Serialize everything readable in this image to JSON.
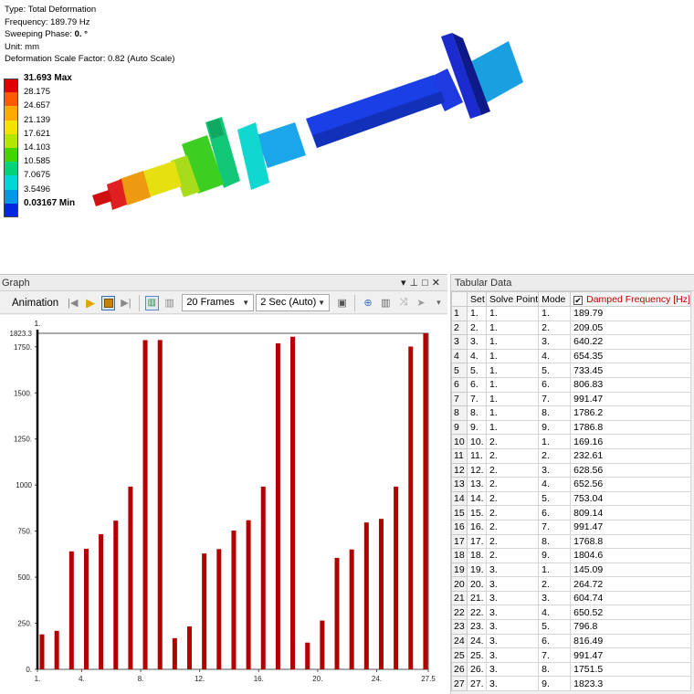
{
  "info": {
    "type_line": "Type: Total Deformation",
    "frequency_line": "Frequency: 189.79 Hz",
    "phase_line_prefix": "Sweeping Phase: ",
    "phase_value": "0. °",
    "unit_line": "Unit: mm",
    "scale_line": "Deformation Scale Factor: 0.82 (Auto Scale)"
  },
  "legend": [
    {
      "label": "31.693 Max",
      "bold": true,
      "color": "#e00000"
    },
    {
      "label": "28.175",
      "bold": false,
      "color": "#ff5a00"
    },
    {
      "label": "24.657",
      "bold": false,
      "color": "#ffaa00"
    },
    {
      "label": "21.139",
      "bold": false,
      "color": "#f6e200"
    },
    {
      "label": "17.621",
      "bold": false,
      "color": "#b4e600"
    },
    {
      "label": "14.103",
      "bold": false,
      "color": "#44d400"
    },
    {
      "label": "10.585",
      "bold": false,
      "color": "#00d37a"
    },
    {
      "label": "7.0675",
      "bold": false,
      "color": "#00d8d8"
    },
    {
      "label": "3.5496",
      "bold": false,
      "color": "#0098e6"
    },
    {
      "label": "0.03167 Min",
      "bold": true,
      "color": "#0028e0"
    }
  ],
  "graph_panel": {
    "title": "Graph",
    "animation_label": "Animation",
    "frames_value": "20 Frames",
    "duration_value": "2 Sec (Auto)"
  },
  "tabular_panel": {
    "title": "Tabular Data",
    "columns": [
      "Set",
      "Solve Point",
      "Mode",
      "Damped Frequency [Hz]"
    ],
    "rows": [
      {
        "n": "1",
        "set": "1.",
        "solve": "1.",
        "mode": "1.",
        "freq": "189.79"
      },
      {
        "n": "2",
        "set": "2.",
        "solve": "1.",
        "mode": "2.",
        "freq": "209.05"
      },
      {
        "n": "3",
        "set": "3.",
        "solve": "1.",
        "mode": "3.",
        "freq": "640.22"
      },
      {
        "n": "4",
        "set": "4.",
        "solve": "1.",
        "mode": "4.",
        "freq": "654.35"
      },
      {
        "n": "5",
        "set": "5.",
        "solve": "1.",
        "mode": "5.",
        "freq": "733.45"
      },
      {
        "n": "6",
        "set": "6.",
        "solve": "1.",
        "mode": "6.",
        "freq": "806.83"
      },
      {
        "n": "7",
        "set": "7.",
        "solve": "1.",
        "mode": "7.",
        "freq": "991.47"
      },
      {
        "n": "8",
        "set": "8.",
        "solve": "1.",
        "mode": "8.",
        "freq": "1786.2"
      },
      {
        "n": "9",
        "set": "9.",
        "solve": "1.",
        "mode": "9.",
        "freq": "1786.8"
      },
      {
        "n": "10",
        "set": "10.",
        "solve": "2.",
        "mode": "1.",
        "freq": "169.16"
      },
      {
        "n": "11",
        "set": "11.",
        "solve": "2.",
        "mode": "2.",
        "freq": "232.61"
      },
      {
        "n": "12",
        "set": "12.",
        "solve": "2.",
        "mode": "3.",
        "freq": "628.56"
      },
      {
        "n": "13",
        "set": "13.",
        "solve": "2.",
        "mode": "4.",
        "freq": "652.56"
      },
      {
        "n": "14",
        "set": "14.",
        "solve": "2.",
        "mode": "5.",
        "freq": "753.04"
      },
      {
        "n": "15",
        "set": "15.",
        "solve": "2.",
        "mode": "6.",
        "freq": "809.14"
      },
      {
        "n": "16",
        "set": "16.",
        "solve": "2.",
        "mode": "7.",
        "freq": "991.47"
      },
      {
        "n": "17",
        "set": "17.",
        "solve": "2.",
        "mode": "8.",
        "freq": "1768.8"
      },
      {
        "n": "18",
        "set": "18.",
        "solve": "2.",
        "mode": "9.",
        "freq": "1804.6"
      },
      {
        "n": "19",
        "set": "19.",
        "solve": "3.",
        "mode": "1.",
        "freq": "145.09"
      },
      {
        "n": "20",
        "set": "20.",
        "solve": "3.",
        "mode": "2.",
        "freq": "264.72"
      },
      {
        "n": "21",
        "set": "21.",
        "solve": "3.",
        "mode": "3.",
        "freq": "604.74"
      },
      {
        "n": "22",
        "set": "22.",
        "solve": "3.",
        "mode": "4.",
        "freq": "650.52"
      },
      {
        "n": "23",
        "set": "23.",
        "solve": "3.",
        "mode": "5.",
        "freq": "796.8"
      },
      {
        "n": "24",
        "set": "24.",
        "solve": "3.",
        "mode": "6.",
        "freq": "816.49"
      },
      {
        "n": "25",
        "set": "25.",
        "solve": "3.",
        "mode": "7.",
        "freq": "991.47"
      },
      {
        "n": "26",
        "set": "26.",
        "solve": "3.",
        "mode": "8.",
        "freq": "1751.5"
      },
      {
        "n": "27",
        "set": "27.",
        "solve": "3.",
        "mode": "9.",
        "freq": "1823.3"
      }
    ]
  },
  "chart_data": {
    "type": "bar",
    "x": [
      1,
      2,
      3,
      4,
      5,
      6,
      7,
      8,
      9,
      10,
      11,
      12,
      13,
      14,
      15,
      16,
      17,
      18,
      19,
      20,
      21,
      22,
      23,
      24,
      25,
      26,
      27
    ],
    "values": [
      189.79,
      209.05,
      640.22,
      654.35,
      733.45,
      806.83,
      991.47,
      1786.2,
      1786.8,
      169.16,
      232.61,
      628.56,
      652.56,
      753.04,
      809.14,
      991.47,
      1768.8,
      1804.6,
      145.09,
      264.72,
      604.74,
      650.52,
      796.8,
      816.49,
      991.47,
      1751.5,
      1823.3
    ],
    "bar_color": "#b20000",
    "ylim": [
      0,
      1823.3
    ],
    "xlim": [
      1,
      27.5
    ],
    "y_ticks": [
      0,
      250,
      500,
      750,
      1000,
      1250,
      1500,
      1750
    ],
    "y_tick_labels": [
      "0.",
      "250.",
      "500.",
      "750.",
      "1000",
      "1250.",
      "1500.",
      "1750."
    ],
    "y_max_label": "1823.3",
    "x_ticks": [
      1,
      4,
      8,
      12,
      16,
      20,
      24,
      27.5
    ],
    "x_tick_labels": [
      "1.",
      "4.",
      "8.",
      "12.",
      "16.",
      "20.",
      "24.",
      "27.5"
    ],
    "cursor_label": "1.",
    "grid": false,
    "xlabel": "",
    "ylabel": ""
  }
}
